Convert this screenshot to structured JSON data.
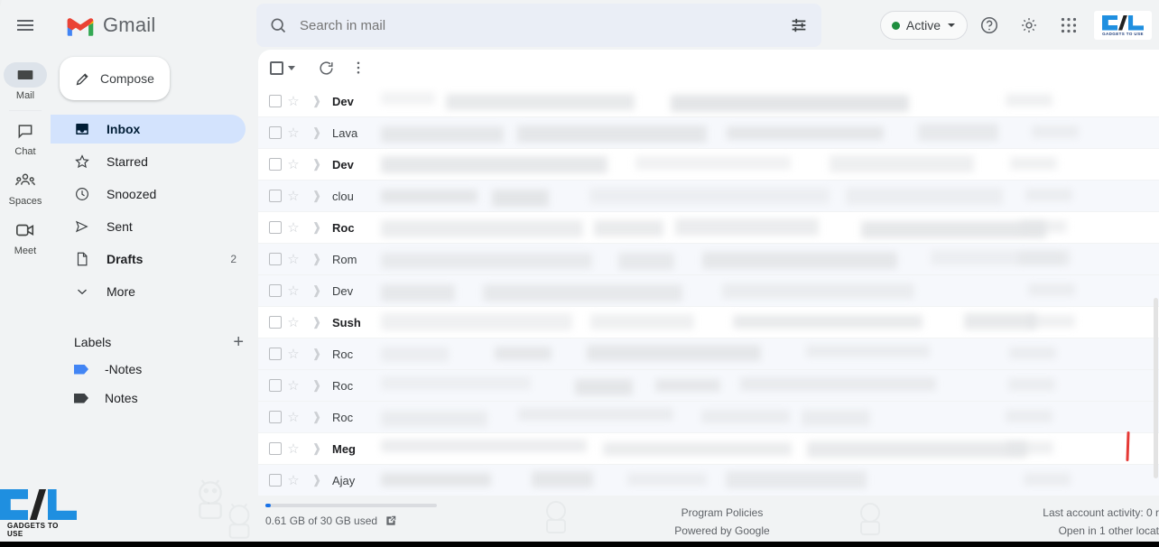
{
  "app": {
    "title": "Gmail",
    "logo_icon": "gmail-m-logo",
    "menu_icon": "hamburger-menu-icon"
  },
  "search": {
    "placeholder": "Search in mail",
    "value": "",
    "search_icon": "search-icon",
    "filter_icon": "tune-filter-icon"
  },
  "topbar": {
    "status_label": "Active",
    "status_color": "#1e8e3e",
    "status_caret_icon": "chevron-down-icon",
    "help_icon": "help-circle-icon",
    "settings_icon": "gear-icon",
    "apps_icon": "apps-grid-icon",
    "logo_text": "GADGETS TO USE"
  },
  "rail": {
    "items": [
      {
        "label": "Mail",
        "icon": "envelope-icon",
        "selected": true
      },
      {
        "label": "Chat",
        "icon": "chat-bubble-icon",
        "selected": false
      },
      {
        "label": "Spaces",
        "icon": "spaces-people-icon",
        "selected": false
      },
      {
        "label": "Meet",
        "icon": "video-camera-icon",
        "selected": false
      }
    ]
  },
  "sidebar": {
    "compose_label": "Compose",
    "compose_icon": "pencil-icon",
    "items": [
      {
        "label": "Inbox",
        "icon": "inbox-icon",
        "count": "",
        "selected": true
      },
      {
        "label": "Starred",
        "icon": "star-icon",
        "count": "",
        "selected": false
      },
      {
        "label": "Snoozed",
        "icon": "clock-icon",
        "count": "",
        "selected": false
      },
      {
        "label": "Sent",
        "icon": "send-icon",
        "count": "",
        "selected": false
      },
      {
        "label": "Drafts",
        "icon": "draft-file-icon",
        "count": "2",
        "selected": false,
        "bold": true
      },
      {
        "label": "More",
        "icon": "chevron-down-icon",
        "count": "",
        "selected": false
      }
    ],
    "labels_header": "Labels",
    "add_label_icon": "plus-icon",
    "labels": [
      {
        "label": "-Notes",
        "color": "#4285f4",
        "icon": "label-tag-icon"
      },
      {
        "label": "Notes",
        "color": "#3c4043",
        "icon": "label-tag-icon"
      }
    ]
  },
  "list_toolbar": {
    "select_all_icon": "checkbox-icon",
    "select_all_caret_icon": "chevron-down-icon",
    "refresh_icon": "refresh-icon",
    "more_icon": "more-vertical-icon"
  },
  "mail_list": {
    "rows": [
      {
        "sender": "Dev",
        "read": false
      },
      {
        "sender": "Lava",
        "read": true
      },
      {
        "sender": "Dev",
        "read": false
      },
      {
        "sender": "clou",
        "read": true
      },
      {
        "sender": "Roc",
        "read": false
      },
      {
        "sender": "Rom",
        "read": true
      },
      {
        "sender": "Dev",
        "read": true
      },
      {
        "sender": "Sush",
        "read": false
      },
      {
        "sender": "Roc",
        "read": true
      },
      {
        "sender": "Roc",
        "read": true
      },
      {
        "sender": "Roc",
        "read": true
      },
      {
        "sender": "Meg",
        "read": false
      },
      {
        "sender": "Ajay",
        "read": true
      }
    ]
  },
  "footer": {
    "storage_text": "0.61 GB of 30 GB used",
    "storage_percent": 2,
    "external_link_icon": "open-in-new-icon",
    "program_policies": "Program Policies",
    "powered_by": "Powered by Google",
    "last_activity": "Last account activity: 0 r",
    "open_elsewhere": "Open in 1 other locat"
  }
}
